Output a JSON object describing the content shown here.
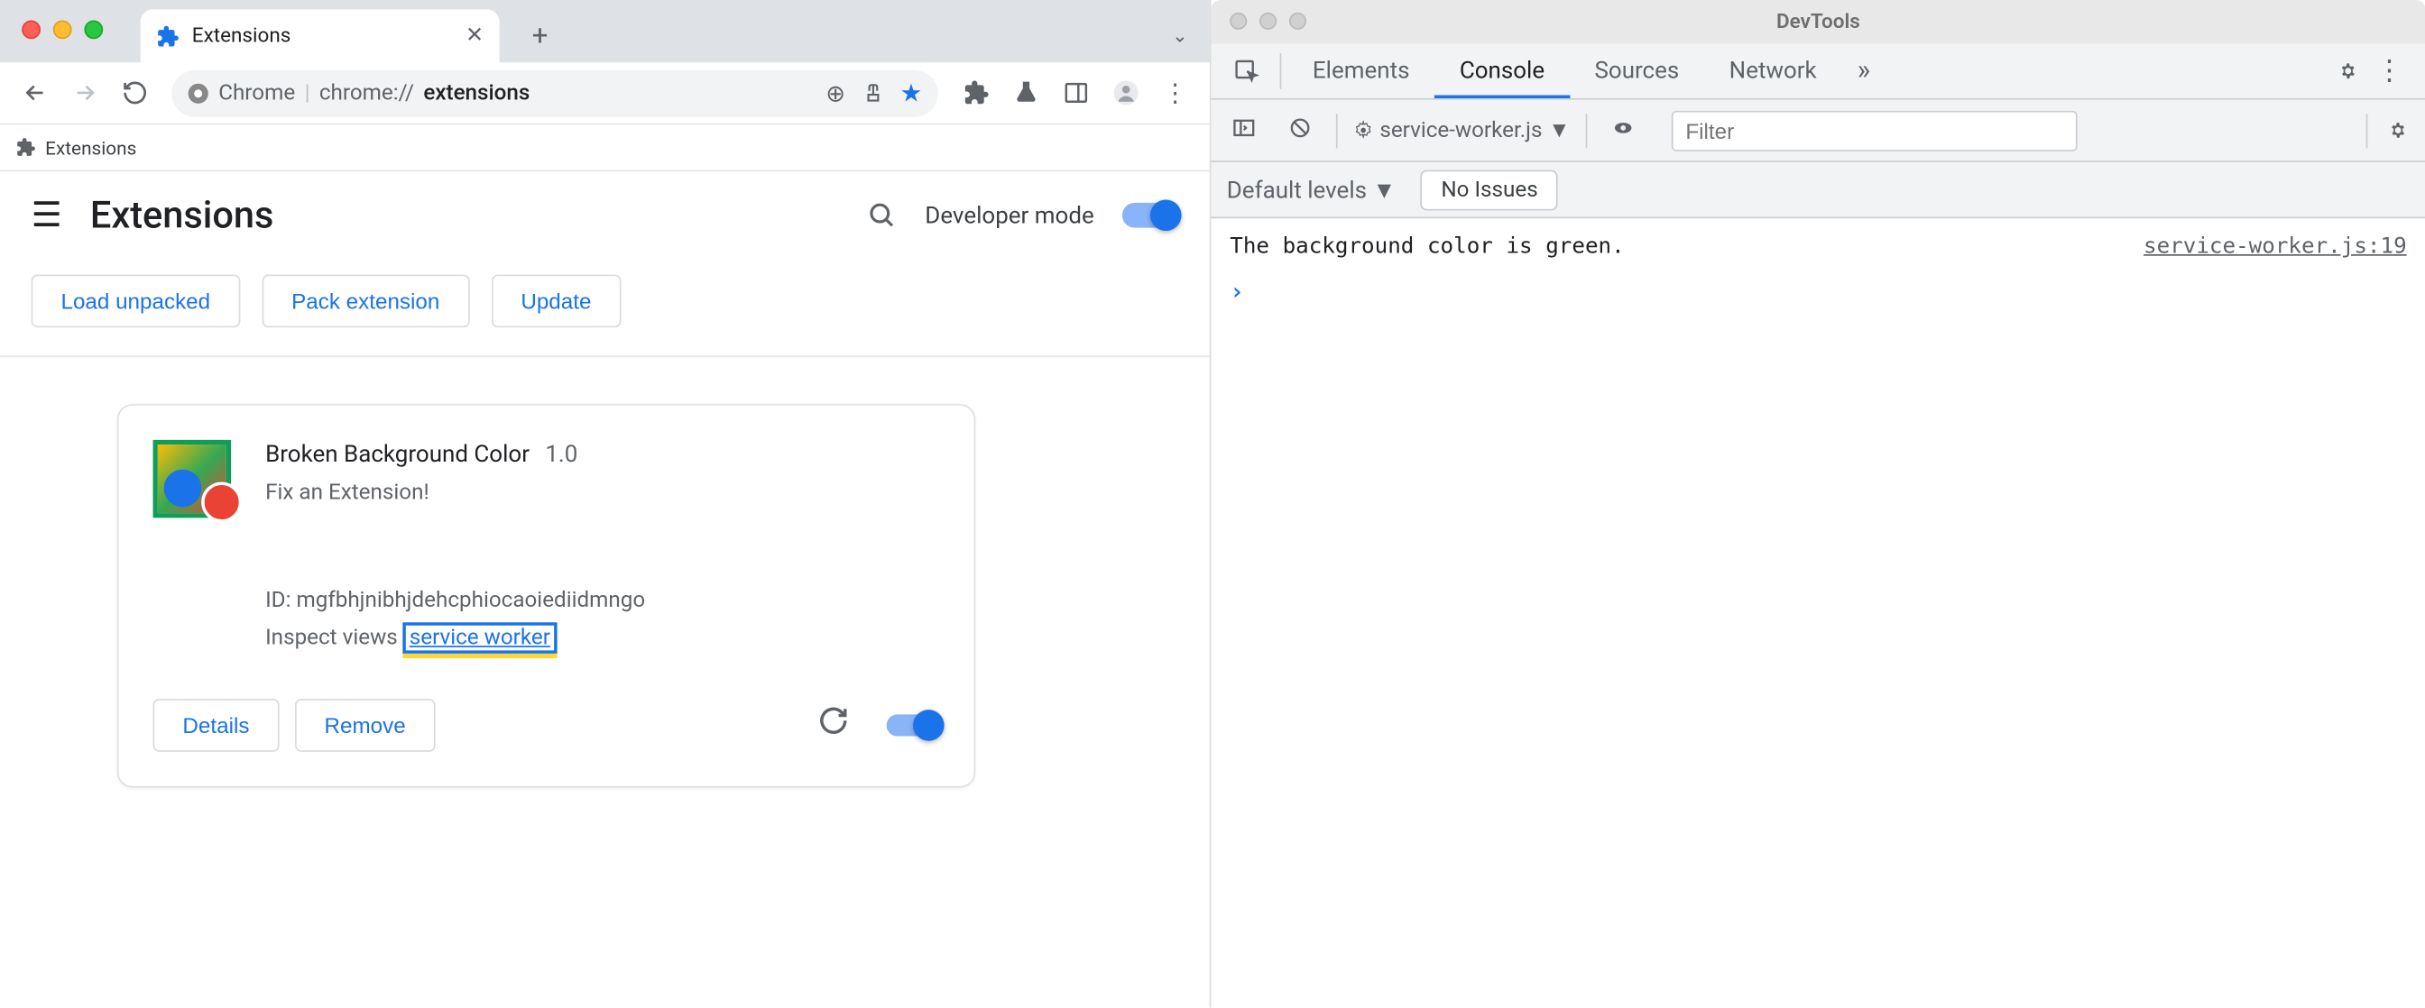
{
  "chrome": {
    "tab": {
      "title": "Extensions"
    },
    "omnibox": {
      "scheme_label": "Chrome",
      "url_prefix": "chrome://",
      "url_bold": "extensions"
    },
    "bookmark_bar": {
      "item": "Extensions"
    },
    "page": {
      "title": "Extensions",
      "dev_mode_label": "Developer mode",
      "buttons": {
        "load_unpacked": "Load unpacked",
        "pack": "Pack extension",
        "update": "Update"
      }
    },
    "card": {
      "name": "Broken Background Color",
      "version": "1.0",
      "desc": "Fix an Extension!",
      "id_label": "ID:",
      "id": "mgfbhjnibhjdehcphiocaoiediidmngo",
      "inspect_label": "Inspect views",
      "inspect_link": "service worker",
      "details": "Details",
      "remove": "Remove"
    }
  },
  "devtools": {
    "title": "DevTools",
    "tabs": {
      "elements": "Elements",
      "console": "Console",
      "sources": "Sources",
      "network": "Network"
    },
    "context": "service-worker.js",
    "filter_placeholder": "Filter",
    "levels": "Default levels",
    "no_issues": "No Issues",
    "log": {
      "msg": "The background color is green.",
      "src": "service-worker.js:19"
    }
  }
}
